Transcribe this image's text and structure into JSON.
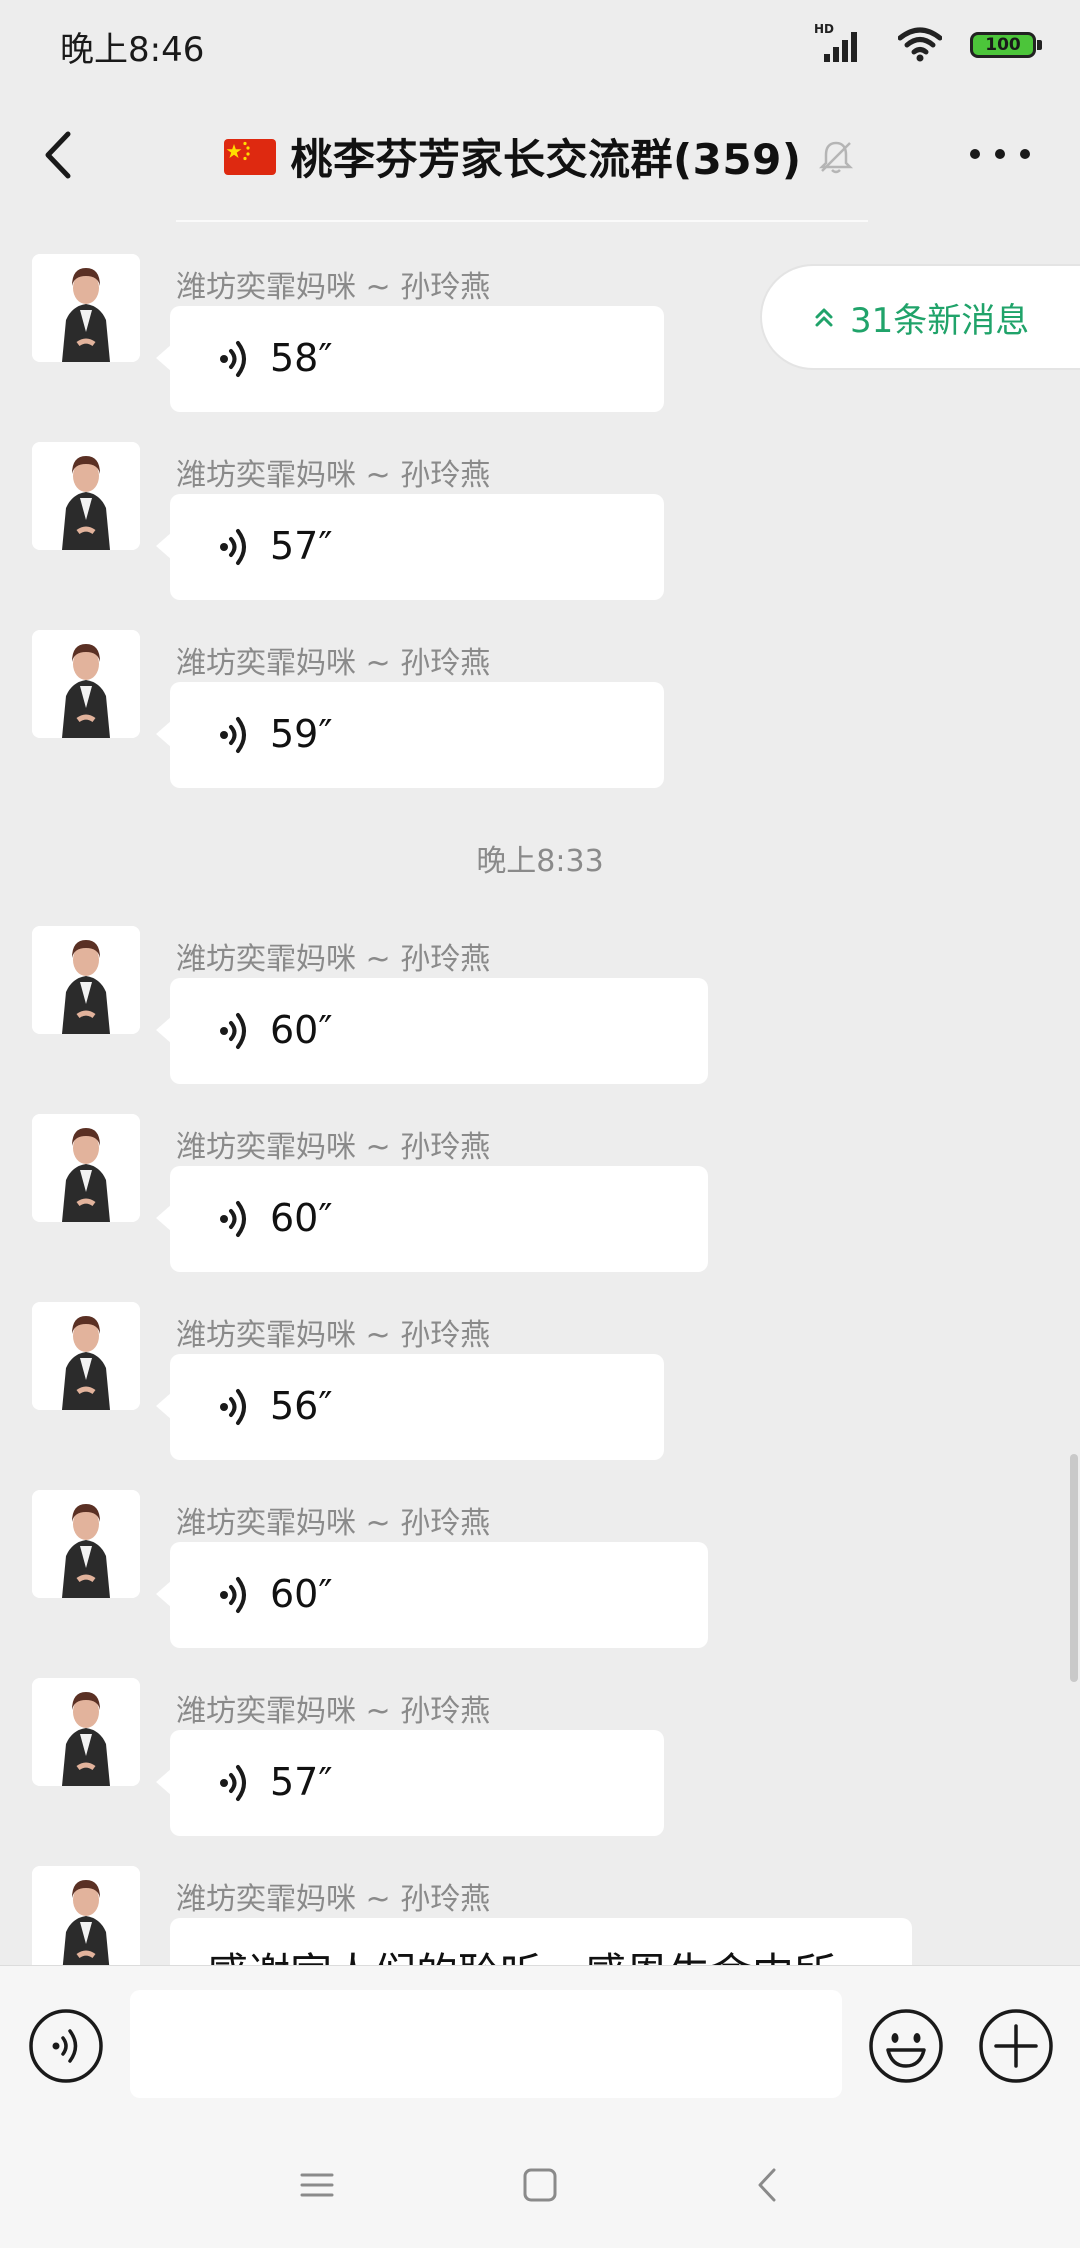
{
  "status_bar": {
    "time": "晚上8:46",
    "network": "HD",
    "battery": "100",
    "signal_icon": "cellular-signal-icon",
    "wifi_icon": "wifi-icon",
    "battery_icon": "battery-icon"
  },
  "header": {
    "back_icon": "back-arrow-icon",
    "flag_icon": "china-flag-icon",
    "title": "桃李芬芳家长交流群(359)",
    "mute_icon": "bell-muted-icon",
    "more_icon": "more-dots-icon"
  },
  "new_messages": {
    "label": "31条新消息",
    "icon": "double-chevron-up-icon"
  },
  "messages": [
    {
      "sender": "潍坊奕霏妈咪 ~ 孙玲燕",
      "type": "voice",
      "duration": "58″"
    },
    {
      "sender": "潍坊奕霏妈咪 ~ 孙玲燕",
      "type": "voice",
      "duration": "57″"
    },
    {
      "sender": "潍坊奕霏妈咪 ~ 孙玲燕",
      "type": "voice",
      "duration": "59″"
    },
    {
      "sender": "潍坊奕霏妈咪 ~ 孙玲燕",
      "type": "voice",
      "duration": "60″"
    },
    {
      "sender": "潍坊奕霏妈咪 ~ 孙玲燕",
      "type": "voice",
      "duration": "60″"
    },
    {
      "sender": "潍坊奕霏妈咪 ~ 孙玲燕",
      "type": "voice",
      "duration": "56″"
    },
    {
      "sender": "潍坊奕霏妈咪 ~ 孙玲燕",
      "type": "voice",
      "duration": "60″"
    },
    {
      "sender": "潍坊奕霏妈咪 ~ 孙玲燕",
      "type": "voice",
      "duration": "57″"
    },
    {
      "sender": "潍坊奕霏妈咪 ~ 孙玲燕",
      "type": "text",
      "text": "感谢家人们的聆听，感恩生命中所"
    }
  ],
  "time_divider": "晚上8:33",
  "input_bar": {
    "voice_icon": "voice-input-icon",
    "emoji_icon": "emoji-icon",
    "plus_icon": "plus-icon",
    "placeholder": ""
  },
  "nav_bar": {
    "menu_icon": "menu-icon",
    "home_icon": "home-icon",
    "back_icon": "back-nav-icon"
  },
  "colors": {
    "background": "#ededed",
    "bubble": "#ffffff",
    "accent_green": "#20a36a",
    "meta_gray": "#8a8a8a",
    "battery_green": "#4cc53a"
  }
}
